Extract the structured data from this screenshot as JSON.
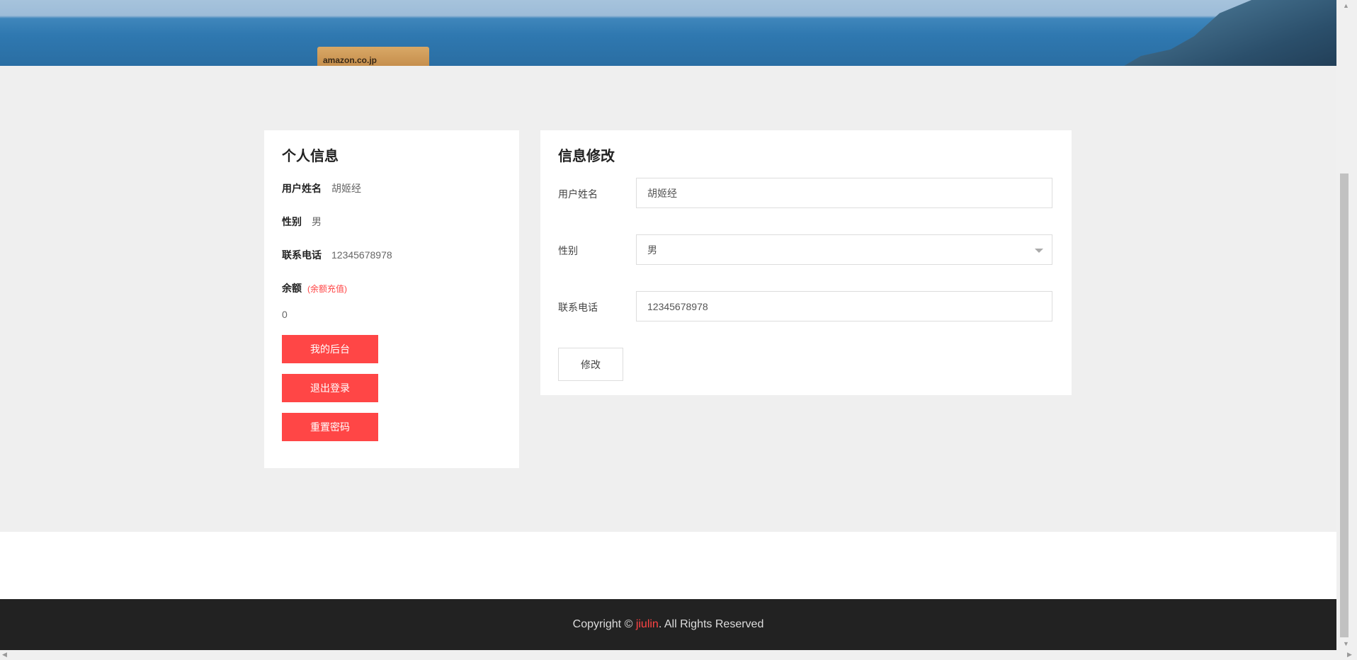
{
  "banner": {
    "box_text": "amazon.co.jp"
  },
  "profile": {
    "title": "个人信息",
    "username_label": "用户姓名",
    "username_value": "胡姬经",
    "gender_label": "性别",
    "gender_value": "男",
    "phone_label": "联系电话",
    "phone_value": "12345678978",
    "balance_label": "余额",
    "recharge_link": "(余额充值)",
    "balance_value": "0",
    "buttons": [
      "我的后台",
      "退出登录",
      "重置密码"
    ]
  },
  "edit": {
    "title": "信息修改",
    "username_label": "用户姓名",
    "username_value": "胡姬经",
    "gender_label": "性别",
    "gender_value": "男",
    "phone_label": "联系电话",
    "phone_value": "12345678978",
    "submit_label": "修改"
  },
  "footer": {
    "prefix": "Copyright © ",
    "brand": "jiulin",
    "suffix": ". All Rights Reserved"
  },
  "colors": {
    "accent": "#ff4646",
    "footer_bg": "#222222",
    "page_bg": "#efefef"
  }
}
